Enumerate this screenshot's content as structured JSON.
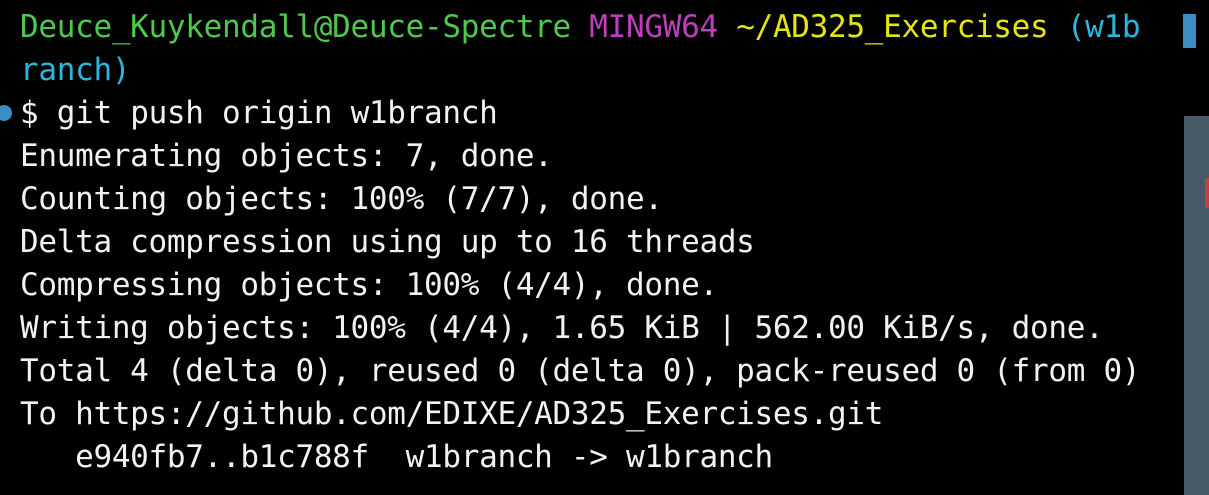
{
  "prompt": {
    "user_host": "Deuce_Kuykendall@Deuce-Spectre",
    "shell": "MINGW64",
    "path": "~/AD325_Exercises",
    "branch_part1": "(w1b",
    "branch_part2": "ranch)"
  },
  "command": {
    "symbol": "$",
    "text": "git push origin w1branch"
  },
  "output": [
    "Enumerating objects: 7, done.",
    "Counting objects: 100% (7/7), done.",
    "Delta compression using up to 16 threads",
    "Compressing objects: 100% (4/4), done.",
    "Writing objects: 100% (4/4), 1.65 KiB | 562.00 KiB/s, done.",
    "Total 4 (delta 0), reused 0 (delta 0), pack-reused 0 (from 0)",
    "To https://github.com/EDIXE/AD325_Exercises.git",
    "   e940fb7..b1c788f  w1branch -> w1branch"
  ],
  "colors": {
    "background": "#000000",
    "user_host": "#4ec94e",
    "shell": "#bc3fbc",
    "path": "#e5e510",
    "branch": "#29b8db",
    "text": "#f2f2f2",
    "accent": "#3b8ec4"
  }
}
